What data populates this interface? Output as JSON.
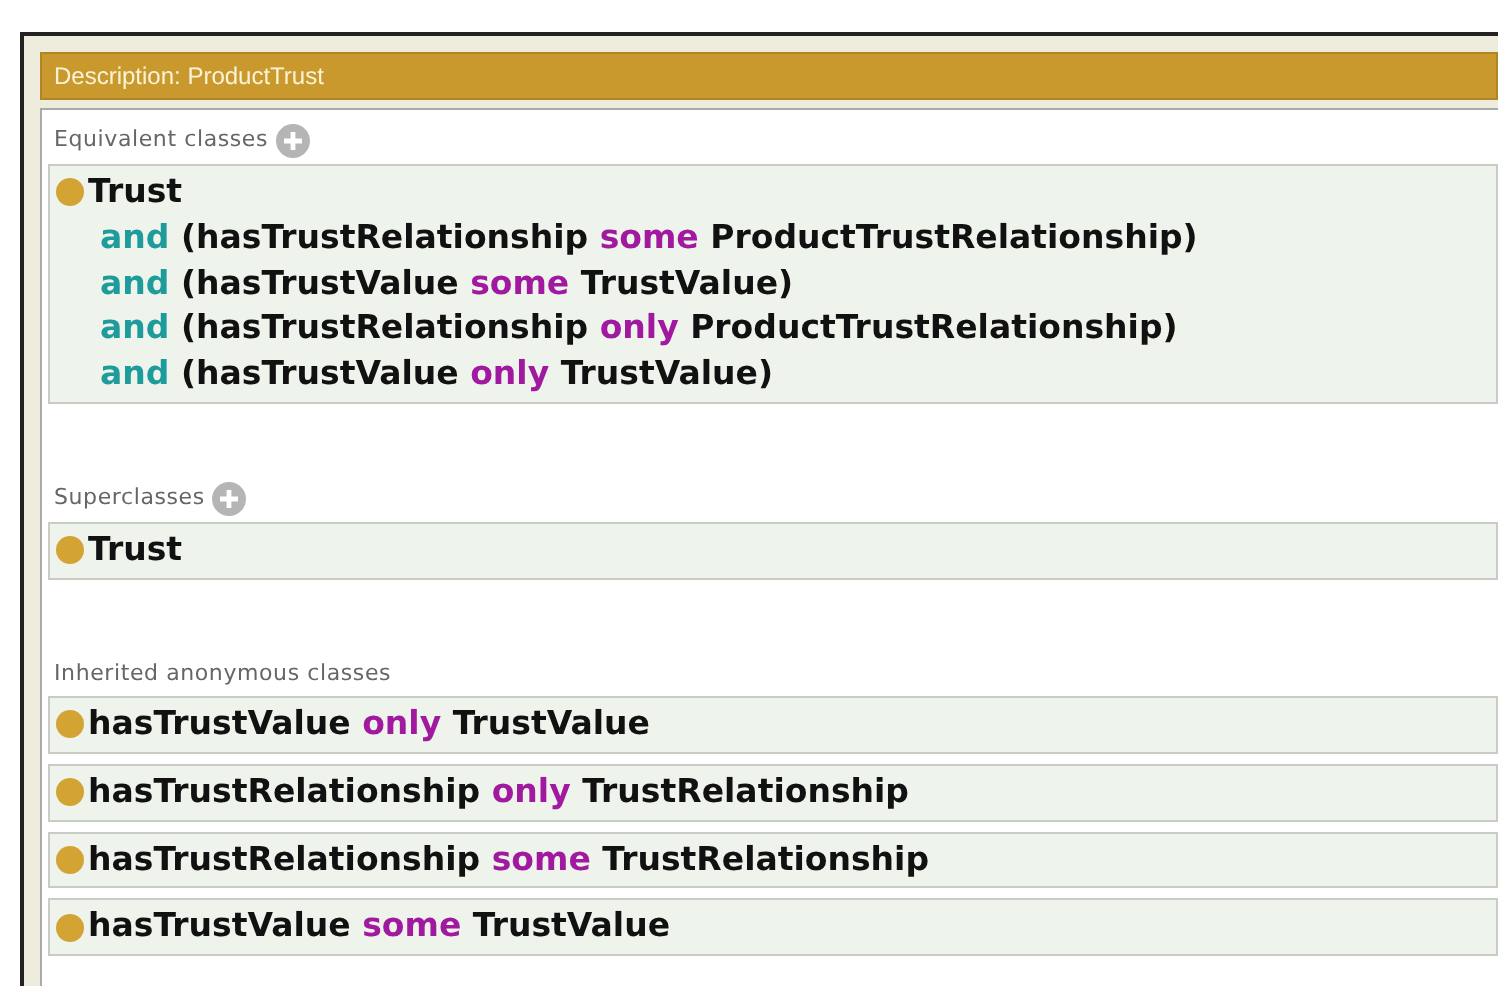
{
  "panel": {
    "title": "Description: ProductTrust"
  },
  "sections": [
    {
      "heading": "Equivalent classes",
      "addable": true,
      "items": [
        {
          "lines": [
            [
              {
                "kind": "entity",
                "text": "Trust"
              }
            ],
            [
              {
                "kind": "and",
                "text": "and"
              },
              {
                "kind": "entity",
                "text": "(hasTrustRelationship"
              },
              {
                "kind": "quantifier",
                "text": "some"
              },
              {
                "kind": "entity",
                "text": "ProductTrustRelationship)"
              }
            ],
            [
              {
                "kind": "and",
                "text": "and"
              },
              {
                "kind": "entity",
                "text": "(hasTrustValue"
              },
              {
                "kind": "quantifier",
                "text": "some"
              },
              {
                "kind": "entity",
                "text": "TrustValue)"
              }
            ],
            [
              {
                "kind": "and",
                "text": "and"
              },
              {
                "kind": "entity",
                "text": "(hasTrustRelationship"
              },
              {
                "kind": "quantifier",
                "text": "only"
              },
              {
                "kind": "entity",
                "text": "ProductTrustRelationship)"
              }
            ],
            [
              {
                "kind": "and",
                "text": "and"
              },
              {
                "kind": "entity",
                "text": "(hasTrustValue"
              },
              {
                "kind": "quantifier",
                "text": "only"
              },
              {
                "kind": "entity",
                "text": "TrustValue)"
              }
            ]
          ]
        }
      ]
    },
    {
      "heading": "Superclasses",
      "addable": true,
      "items": [
        {
          "lines": [
            [
              {
                "kind": "entity",
                "text": "Trust"
              }
            ]
          ]
        }
      ]
    },
    {
      "heading": "Inherited anonymous classes",
      "addable": false,
      "items": [
        {
          "lines": [
            [
              {
                "kind": "entity",
                "text": "hasTrustValue"
              },
              {
                "kind": "quantifier",
                "text": "only"
              },
              {
                "kind": "entity",
                "text": "TrustValue"
              }
            ]
          ]
        },
        {
          "lines": [
            [
              {
                "kind": "entity",
                "text": "hasTrustRelationship"
              },
              {
                "kind": "quantifier",
                "text": "only"
              },
              {
                "kind": "entity",
                "text": "TrustRelationship"
              }
            ]
          ]
        },
        {
          "lines": [
            [
              {
                "kind": "entity",
                "text": "hasTrustRelationship"
              },
              {
                "kind": "quantifier",
                "text": "some"
              },
              {
                "kind": "entity",
                "text": "TrustRelationship"
              }
            ]
          ]
        },
        {
          "lines": [
            [
              {
                "kind": "entity",
                "text": "hasTrustValue"
              },
              {
                "kind": "quantifier",
                "text": "some"
              },
              {
                "kind": "entity",
                "text": "TrustValue"
              }
            ]
          ]
        }
      ]
    }
  ]
}
